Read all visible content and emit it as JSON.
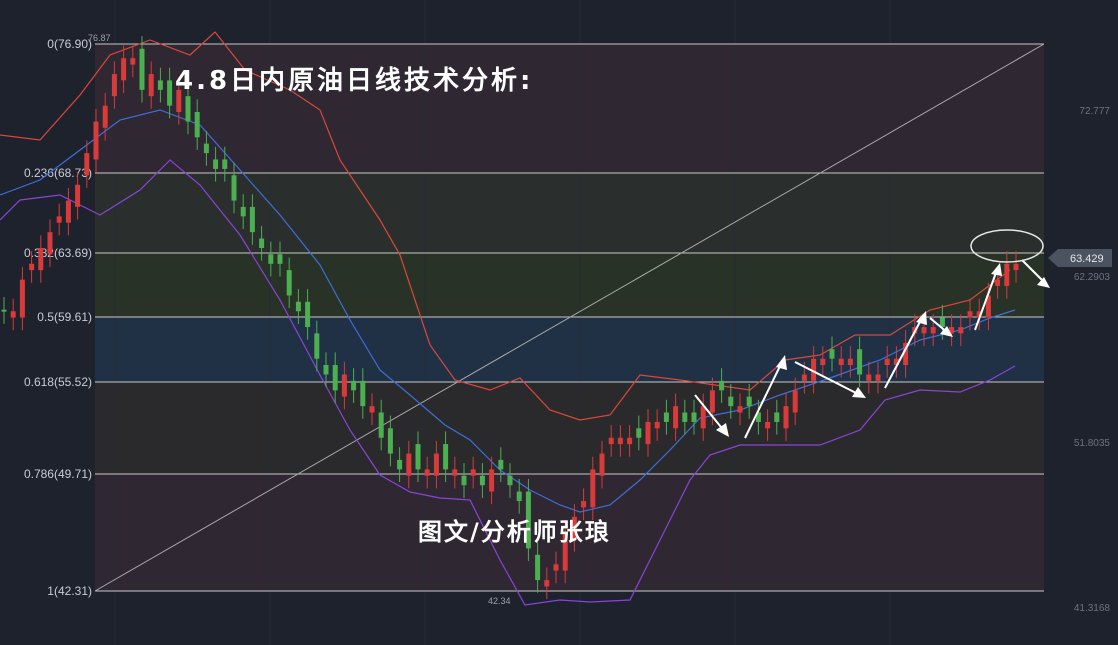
{
  "title": "4.8日内原油日线技术分析:",
  "author": "图文/分析师张琅",
  "chart_data": {
    "type": "candlestick",
    "ylim": [
      39.0,
      79.6
    ],
    "fib_levels": [
      {
        "ratio": "0",
        "price": 76.9,
        "label": "0(76.90)"
      },
      {
        "ratio": "0.236",
        "price": 68.73,
        "label": "0.236(68.73)"
      },
      {
        "ratio": "0.382",
        "price": 63.69,
        "label": "0.382(63.69)"
      },
      {
        "ratio": "0.5",
        "price": 59.61,
        "label": "0.5(59.61)"
      },
      {
        "ratio": "0.618",
        "price": 55.52,
        "label": "0.618(55.52)"
      },
      {
        "ratio": "0.786",
        "price": 49.71,
        "label": "0.786(49.71)"
      },
      {
        "ratio": "1",
        "price": 42.31,
        "label": "1(42.31)"
      }
    ],
    "right_axis": [
      {
        "value": 72.777,
        "label": "72.777"
      },
      {
        "value": 51.8035,
        "label": "51.8035"
      },
      {
        "value": 41.3168,
        "label": "41.3168"
      }
    ],
    "current_price": {
      "value": 63.429,
      "label": "63.429"
    },
    "secondary_price": {
      "value": 62.2903,
      "label": "62.2903"
    },
    "high_mark": {
      "value": 76.87,
      "label": "76.87"
    },
    "low_mark": {
      "value": 42.34,
      "label": "42.34"
    },
    "series": [
      {
        "type": "candlestick",
        "close": [
          60,
          60,
          62,
          63,
          64,
          65,
          66,
          67,
          68,
          70,
          72,
          73,
          75,
          76,
          76,
          74,
          75,
          74,
          73,
          74,
          72,
          71,
          70,
          69,
          69,
          67,
          66,
          65,
          64,
          63,
          63,
          61,
          60,
          59,
          57,
          56,
          55,
          56,
          55,
          54,
          54,
          52,
          51,
          50,
          51,
          50,
          50,
          51,
          50,
          50,
          49,
          50,
          49,
          50,
          50,
          49,
          48,
          45,
          43,
          43,
          44,
          46,
          47,
          48,
          50,
          51,
          52,
          52,
          52,
          52,
          53,
          53,
          53,
          54,
          53,
          53,
          54,
          55,
          55,
          54,
          54,
          54,
          53,
          53,
          53,
          54,
          55,
          56,
          57,
          57,
          57,
          57,
          57,
          56,
          56,
          56,
          57,
          57,
          58,
          59,
          59,
          59,
          59,
          59,
          59,
          60,
          60,
          61,
          62,
          63,
          63
        ]
      },
      {
        "name": "middle band",
        "type": "line",
        "color": "#3e6fd8"
      },
      {
        "name": "upper band",
        "type": "line",
        "color": "#d9483b"
      },
      {
        "name": "lower band",
        "type": "line",
        "color": "#8a44d6"
      }
    ],
    "colors": {
      "up": "#d93a3a",
      "down": "#4caf50",
      "white_arrows": "#ffffff"
    }
  }
}
